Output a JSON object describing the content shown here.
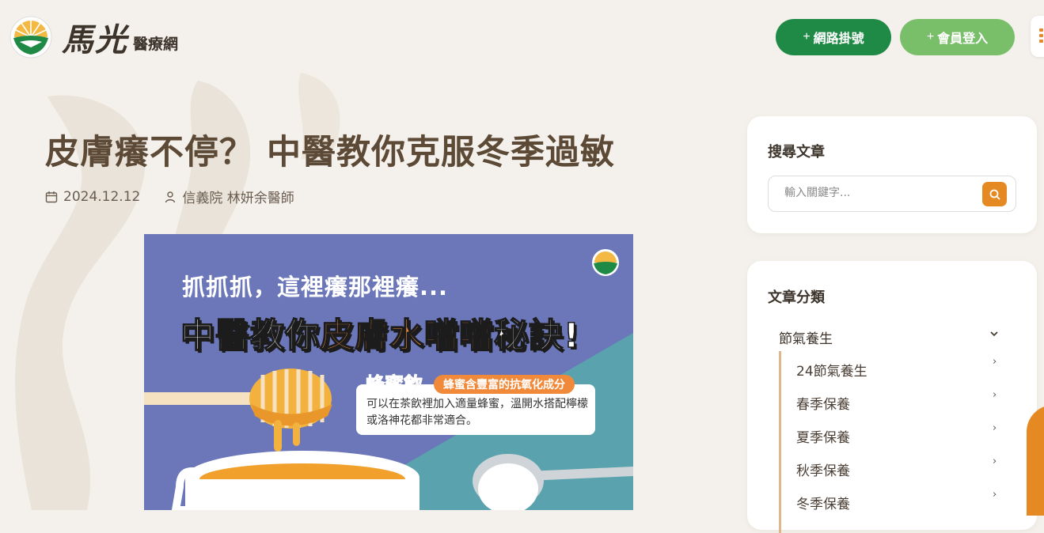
{
  "header": {
    "brand": "馬光",
    "brand_sub": "醫療網",
    "register_plus": "+",
    "register_label": "網路掛號",
    "login_plus": "+",
    "login_label": "會員登入"
  },
  "article": {
    "title": "皮膚癢不停？ 中醫教你克服冬季過敏",
    "date": "2024.12.12",
    "author": "信義院 林妍余醫師"
  },
  "hero": {
    "line1": "抓抓抓，這裡癢那裡癢...",
    "line2_a": "中醫教你",
    "line2_b": "皮膚水噹噹",
    "line2_c": "秘訣!",
    "honey_title": "蜂蜜飲",
    "honey_tag": "蜂蜜含豐富的抗氧化成分",
    "honey_desc": "可以在茶飲裡加入適量蜂蜜，溫開水搭配檸檬或洛神花都非常適合。"
  },
  "sidebar": {
    "search_title": "搜尋文章",
    "search_placeholder": "輸入關鍵字...",
    "category_title": "文章分類",
    "category_parent": "節氣養生",
    "categories": [
      "24節氣養生",
      "春季保養",
      "夏季保養",
      "秋季保養",
      "冬季保養"
    ]
  },
  "colors": {
    "background": "#f4f1ec",
    "brand_green": "#1f8a45",
    "light_green": "#79bf6a",
    "accent_orange": "#e58a22",
    "hero_purple": "#6b77b8",
    "hero_teal": "#5aa3ae"
  },
  "icons": [
    "logo-mark",
    "calendar-icon",
    "user-icon",
    "search-icon",
    "chevron-down-icon",
    "chevron-right-icon",
    "menu-icon"
  ]
}
